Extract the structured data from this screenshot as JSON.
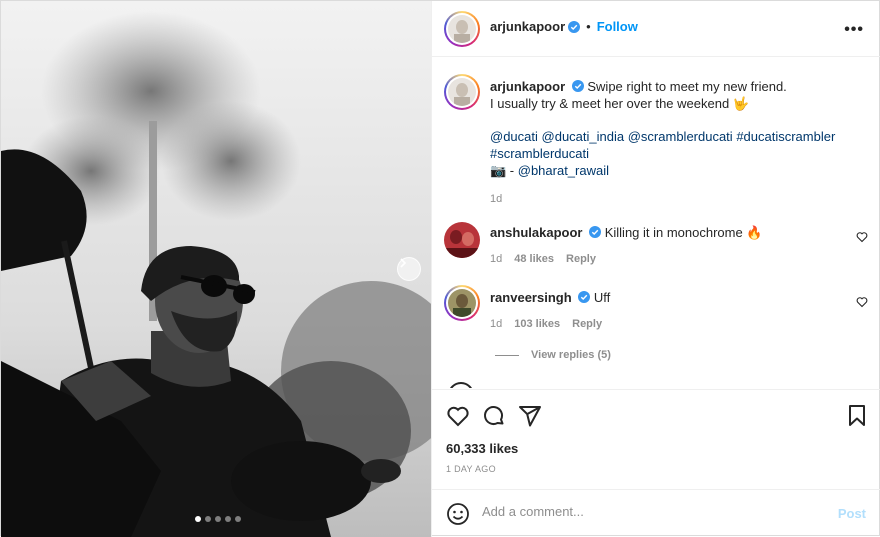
{
  "post": {
    "author": "arjunkapoor",
    "follow_label": "Follow",
    "separator": "•",
    "more_label": "•••",
    "carousel": {
      "slides": 5,
      "active_index": 0
    }
  },
  "caption": {
    "username": "arjunkapoor",
    "line1": "Swipe right to meet my new friend.",
    "line2": "I usually try & meet her over the weekend 🤟",
    "tags": [
      "@ducati",
      "@ducati_india",
      "@scramblerducati",
      "#ducatiscrambler",
      "#scramblerducati"
    ],
    "credit_prefix": "📷 - ",
    "credit_handle": "@bharat_rawail",
    "age": "1d"
  },
  "comments": [
    {
      "username": "anshulakapoor",
      "text": "Killing it in monochrome 🔥",
      "age": "1d",
      "likes": "48 likes",
      "reply_label": "Reply"
    },
    {
      "username": "ranveersingh",
      "text": "Uff",
      "age": "1d",
      "likes": "103 likes",
      "reply_label": "Reply"
    }
  ],
  "view_replies": "View replies (5)",
  "likes_count": "60,333 likes",
  "posted_ago": "1 DAY AGO",
  "add_comment": {
    "placeholder": "Add a comment...",
    "post_label": "Post"
  },
  "colors": {
    "link": "#00376b",
    "accent": "#0095f6",
    "muted": "#8e8e8e",
    "verified": "#3897f0"
  },
  "icons": [
    "heart-icon",
    "comment-icon",
    "share-icon",
    "bookmark-icon",
    "emoji-icon",
    "verified-icon",
    "chevron-right-icon"
  ]
}
